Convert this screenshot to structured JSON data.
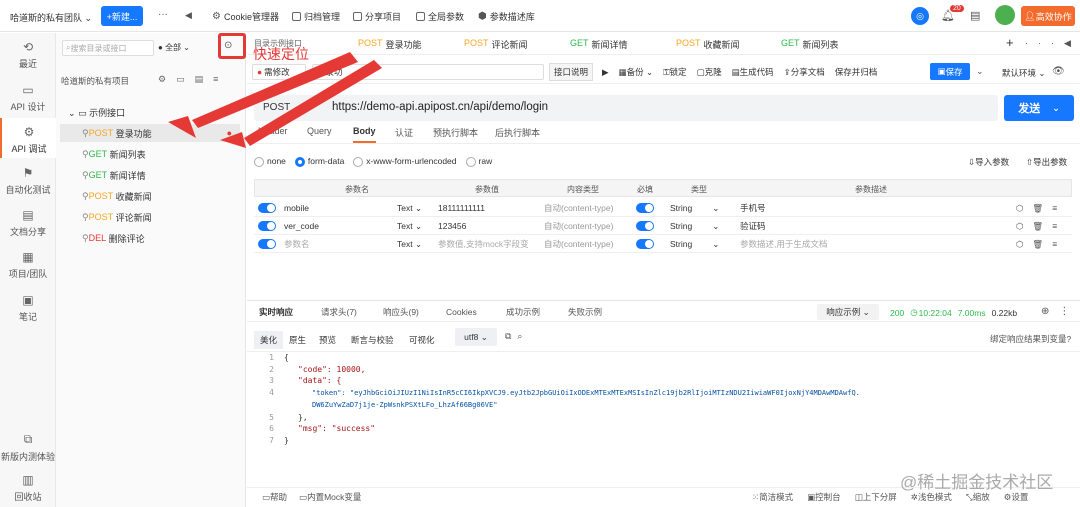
{
  "topbar": {
    "team": "哈道斯的私有团队",
    "new_btn": "+新建...",
    "more": "···",
    "back": "◀",
    "nav": [
      "Cookie管理器",
      "归档管理",
      "分享项目",
      "全局参数",
      "参数描述库"
    ],
    "badge": "20",
    "collab": "高效协作"
  },
  "leftnav": [
    {
      "label": "最近",
      "icon": "⟲"
    },
    {
      "label": "API 设计",
      "icon": "▭"
    },
    {
      "label": "API 调试",
      "icon": "⚙"
    },
    {
      "label": "自动化测试",
      "icon": "⚑"
    },
    {
      "label": "文档分享",
      "icon": "▤"
    },
    {
      "label": "项目/团队",
      "icon": "▦"
    },
    {
      "label": "笔记",
      "icon": "▣"
    },
    {
      "label": "新版内测体验",
      "icon": "⧉"
    },
    {
      "label": "回收站",
      "icon": "▥"
    }
  ],
  "tree": {
    "search_placeholder": "搜索目录或接口",
    "filter": "全部",
    "project": "哈道斯的私有项目",
    "folder": "示例接口",
    "items": [
      {
        "method": "POST",
        "name": "登录功能",
        "m": "post"
      },
      {
        "method": "GET",
        "name": "新闻列表",
        "m": "get"
      },
      {
        "method": "GET",
        "name": "新闻详情",
        "m": "get"
      },
      {
        "method": "POST",
        "name": "收藏新闻",
        "m": "post"
      },
      {
        "method": "POST",
        "name": "评论新闻",
        "m": "post"
      },
      {
        "method": "DEL",
        "name": "删除评论",
        "m": "del"
      }
    ]
  },
  "callout": "快速定位",
  "tabs": [
    {
      "method": "POST",
      "name": "登录功能",
      "m": "post"
    },
    {
      "method": "POST",
      "name": "评论新闻",
      "m": "post"
    },
    {
      "method": "GET",
      "name": "新闻详情",
      "m": "get"
    },
    {
      "method": "POST",
      "name": "收藏新闻",
      "m": "post"
    },
    {
      "method": "GET",
      "name": "新闻列表",
      "m": "get"
    }
  ],
  "tab_partial": "目录示例接口",
  "toolbar": {
    "status": "需修改",
    "name_value": "登录功",
    "desc": "接口说明",
    "items": [
      "备份",
      "锁定",
      "克隆",
      "生成代码",
      "分享文档",
      "保存并归档"
    ],
    "save": "保存",
    "env": "默认环境"
  },
  "url": {
    "method": "POST",
    "value": "https://demo-api.apipost.cn/api/demo/login",
    "send": "发送"
  },
  "subtabs": [
    "Header",
    "Query",
    "Body",
    "认证",
    "预执行脚本",
    "后执行脚本"
  ],
  "body_types": [
    "none",
    "form-data",
    "x-www-form-urlencoded",
    "raw"
  ],
  "import": "导入参数",
  "export": "导出参数",
  "grid": {
    "headers": [
      "参数名",
      "参数值",
      "内容类型",
      "必填",
      "类型",
      "参数描述"
    ],
    "rows": [
      {
        "name": "mobile",
        "ptype": "Text",
        "value": "18111111111",
        "ctype": "自动(content-type)",
        "type": "String",
        "desc": "手机号"
      },
      {
        "name": "ver_code",
        "ptype": "Text",
        "value": "123456",
        "ctype": "自动(content-type)",
        "type": "String",
        "desc": "验证码"
      },
      {
        "name": "参数名",
        "ptype": "Text",
        "value": "参数值,支持mock字段变",
        "ctype": "自动(content-type)",
        "type": "String",
        "desc": "参数描述,用于生成文档"
      }
    ]
  },
  "resp_tabs": [
    "实时响应",
    "请求头(7)",
    "响应头(9)",
    "Cookies",
    "成功示例",
    "失败示例"
  ],
  "resp_example": "响应示例",
  "resp_stats": {
    "code": "200",
    "time": "10:22:04",
    "duration": "7.00ms",
    "size": "0.22kb"
  },
  "view_tabs": [
    "美化",
    "原生",
    "预览",
    "断言与校验",
    "可视化"
  ],
  "encoding": "utf8",
  "bind_link": "绑定响应结果到变量?",
  "code_lines": [
    "{",
    "\"code\": 10000,",
    "\"data\": {",
    "\"token\": \"eyJhbGciOiJIUzI1NiIsInR5cCI6IkpXVCJ9.eyJtb2JpbGUiOiIxODExMTExMTExMSIsInZlc19jb2RlIjoiMTIzNDU2IiwiaWF0IjoxNjY4MDAwMDAwfQ.",
    "DW6ZuYwZaD7j1je-ZpWsnkPSXtLFo_LhzAf66Bg06VE\"",
    "},",
    "\"msg\": \"success\"",
    "}"
  ],
  "bottom": {
    "left": [
      "帮助",
      "内置Mock变量"
    ],
    "right": [
      "简洁模式",
      "控制台",
      "上下分屏",
      "浅色模式",
      "缩放",
      "设置"
    ]
  },
  "watermark": "@稀土掘金技术社区"
}
